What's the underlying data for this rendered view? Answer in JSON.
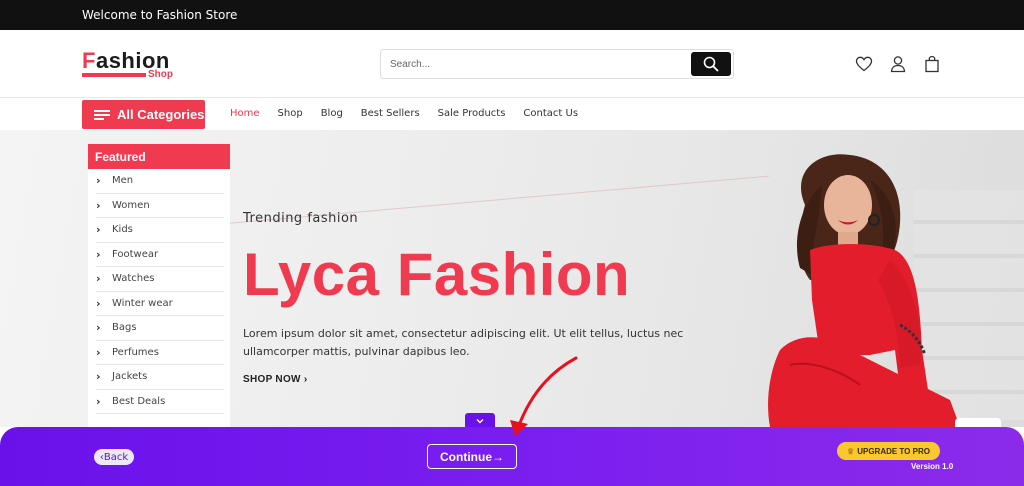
{
  "topbar": {
    "welcome": "Welcome to Fashion Store"
  },
  "header": {
    "logo_first_letter": "F",
    "logo_rest": "ashion",
    "logo_sub": "Shop",
    "search_placeholder": "Search...",
    "icons": [
      "heart-icon",
      "user-icon",
      "bag-icon"
    ]
  },
  "nav": {
    "all_categories": "All Categories",
    "links": [
      "Home",
      "Shop",
      "Blog",
      "Best Sellers",
      "Sale Products",
      "Contact Us"
    ],
    "active": "Home"
  },
  "sidebar": {
    "heading": "Featured",
    "items": [
      "Men",
      "Women",
      "Kids",
      "Footwear",
      "Watches",
      "Winter wear",
      "Bags",
      "Perfumes",
      "Jackets",
      "Best Deals"
    ]
  },
  "hero": {
    "kicker": "Trending fashion",
    "title": "Lyca Fashion",
    "description": "Lorem ipsum dolor sit amet, consectetur adipiscing elit. Ut elit tellus, luctus nec ullamcorper mattis, pulvinar dapibus leo.",
    "cta": "SHOP NOW"
  },
  "onboarding": {
    "back": "Back",
    "continue": "Continue",
    "upgrade": "UPGRADE TO PRO",
    "version": "Version 1.0"
  },
  "colors": {
    "accent": "#ef3a4f",
    "bar": "#6a11ea",
    "upgrade": "#f9c72e"
  }
}
